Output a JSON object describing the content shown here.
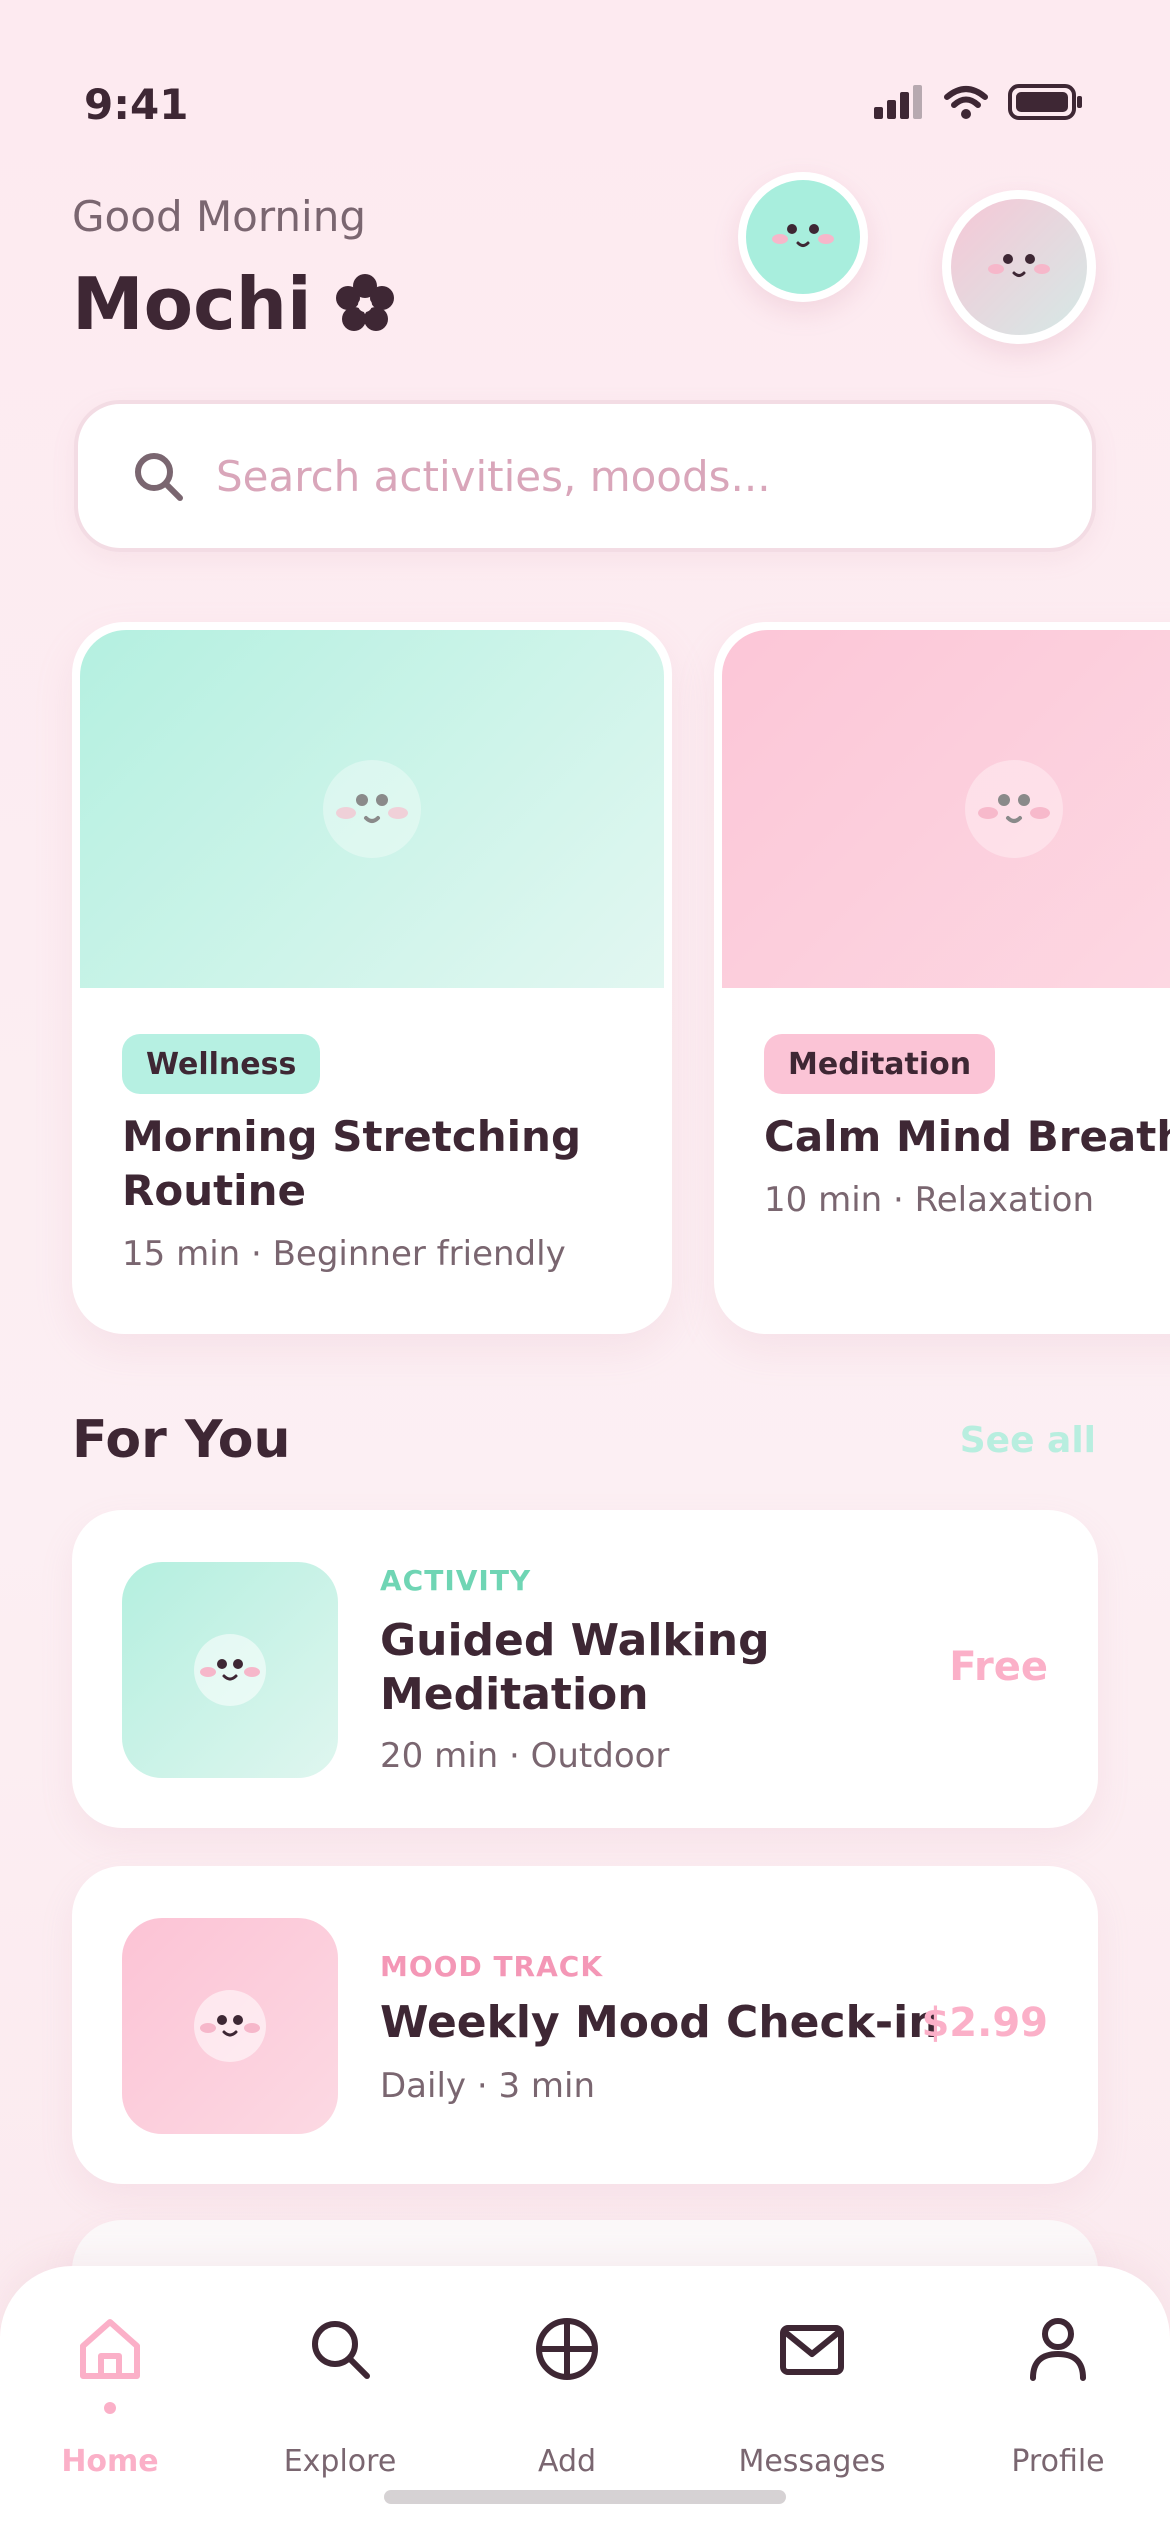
{
  "status_bar": {
    "time": "9:41"
  },
  "header": {
    "greeting": "Good Morning",
    "username": "Mochi"
  },
  "search": {
    "placeholder": "Search activities, moods..."
  },
  "featured": [
    {
      "tag": "Wellness",
      "title": "Morning Stretching Routine",
      "meta": "15 min · Beginner friendly",
      "color": "#B4F0E0"
    },
    {
      "tag": "Meditation",
      "title": "Calm Mind Breathin",
      "meta": "10 min · Relaxation",
      "color": "#FCC6D7"
    }
  ],
  "for_you": {
    "title": "For You",
    "see_all": "See all",
    "items": [
      {
        "category": "ACTIVITY",
        "title": "Guided Walking Meditation",
        "meta": "20 min · Outdoor",
        "price": "Free"
      },
      {
        "category": "MOOD TRACK",
        "title": "Weekly Mood Check-in",
        "meta": "Daily · 3 min",
        "price": "$2.99"
      }
    ]
  },
  "tabbar": {
    "items": [
      {
        "label": "Home",
        "icon": "home-icon",
        "active": true
      },
      {
        "label": "Explore",
        "icon": "search-icon"
      },
      {
        "label": "Add",
        "icon": "add-icon"
      },
      {
        "label": "Messages",
        "icon": "mail-icon"
      },
      {
        "label": "Profile",
        "icon": "user-icon"
      }
    ]
  },
  "colors": {
    "background": "#FDEBF0",
    "text_primary": "#3E2734",
    "mint": "#B4F0E0",
    "pink": "#FBB0C8",
    "accent_mint_text": "#6FD5B4",
    "accent_pink_text": "#F497B6"
  }
}
